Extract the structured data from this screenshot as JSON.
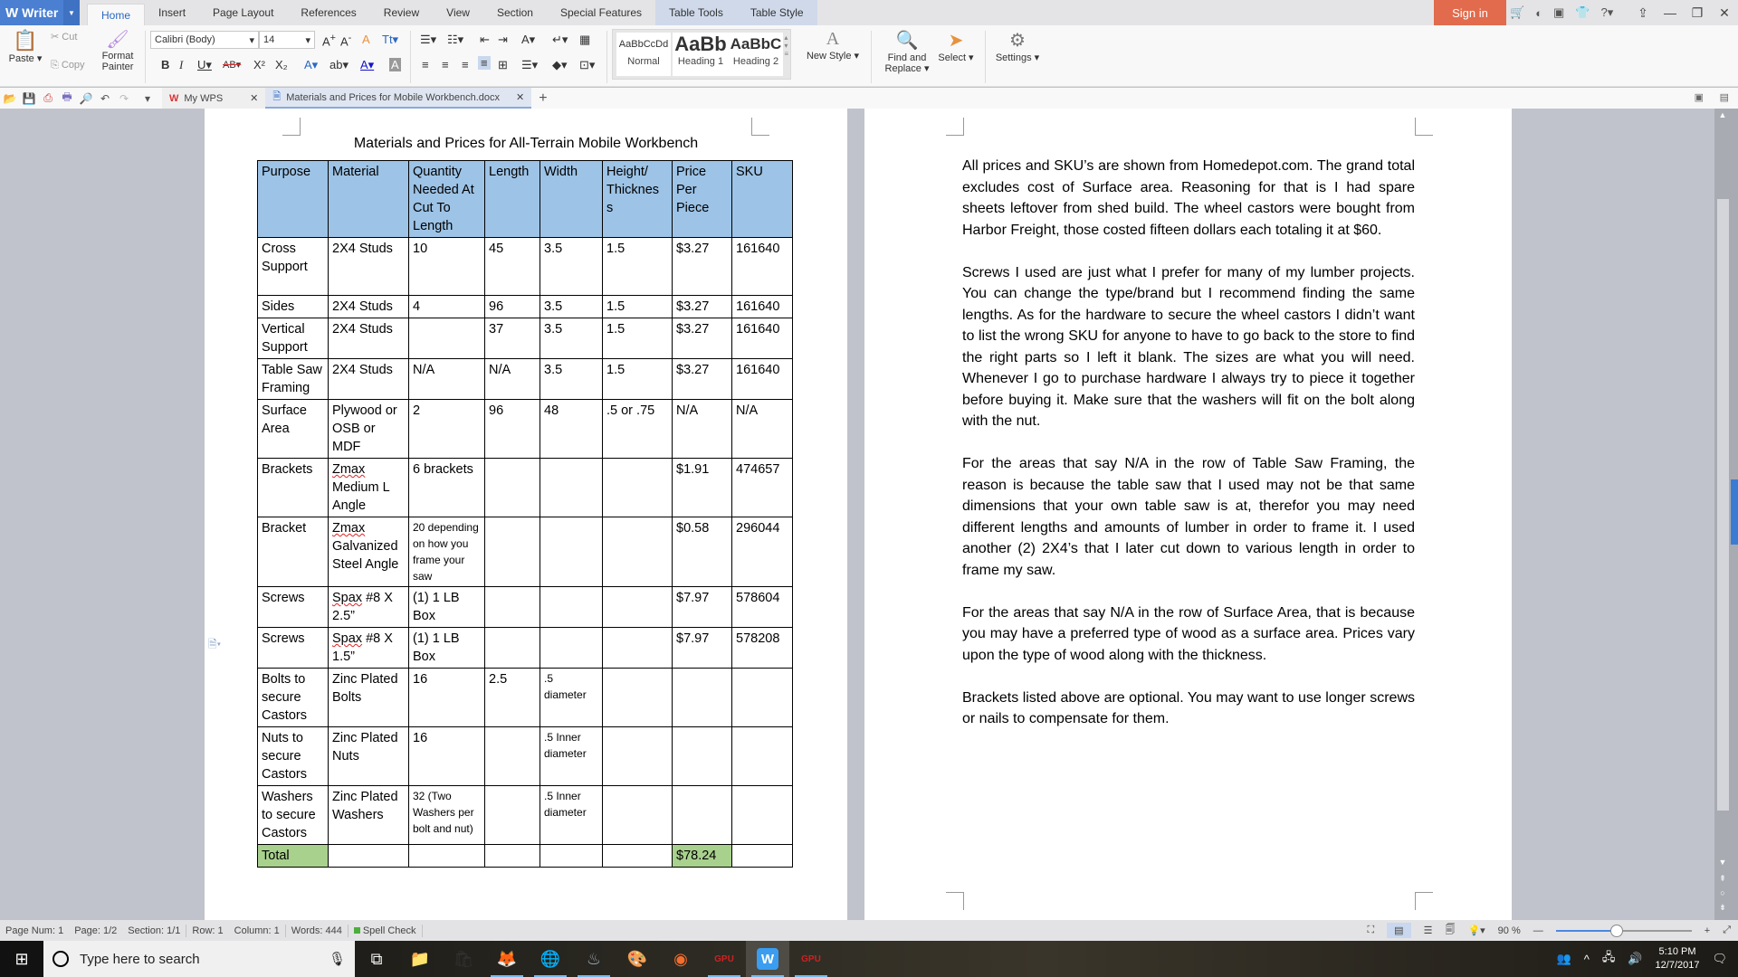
{
  "app": {
    "name": "Writer",
    "logo": "W"
  },
  "menu_tabs": [
    {
      "label": "Home",
      "active": true
    },
    {
      "label": "Insert"
    },
    {
      "label": "Page Layout"
    },
    {
      "label": "References"
    },
    {
      "label": "Review"
    },
    {
      "label": "View"
    },
    {
      "label": "Section"
    },
    {
      "label": "Special Features"
    },
    {
      "label": "Table Tools",
      "contextual": true
    },
    {
      "label": "Table Style",
      "contextual": true
    }
  ],
  "signin_label": "Sign in",
  "ribbon": {
    "paste": "Paste",
    "cut": "Cut",
    "copy": "Copy",
    "format_painter_1": "Format",
    "format_painter_2": "Painter",
    "font_name": "Calibri (Body)",
    "font_size": "14",
    "styles": [
      {
        "preview": "AaBbCcDd",
        "label": "Normal"
      },
      {
        "preview": "AaBb",
        "label": "Heading 1"
      },
      {
        "preview": "AaBbC",
        "label": "Heading 2"
      }
    ],
    "new_style": "New Style",
    "find_replace_1": "Find and",
    "find_replace_2": "Replace",
    "select": "Select",
    "settings": "Settings"
  },
  "doc_tabs": [
    {
      "label": "My WPS",
      "icon": "wps-icon"
    },
    {
      "label": "Materials and Prices for Mobile Workbench.docx",
      "icon": "doc-icon",
      "active": true
    }
  ],
  "document": {
    "title": "Materials and Prices for All-Terrain Mobile Workbench",
    "table": {
      "headers": [
        "Purpose",
        "Material",
        "Quantity Needed At Cut To Length",
        "Length",
        "Width",
        "Height/ Thicknes s",
        "Price Per Piece",
        "SKU"
      ],
      "rows": [
        [
          "Cross Support",
          "2X4 Studs",
          "10",
          "45",
          "3.5",
          "1.5",
          "$3.27",
          "161640"
        ],
        [
          "Sides",
          "2X4 Studs",
          "4",
          "96",
          "3.5",
          "1.5",
          "$3.27",
          "161640"
        ],
        [
          "Vertical Support",
          "2X4 Studs",
          "",
          "37",
          "3.5",
          "1.5",
          "$3.27",
          "161640"
        ],
        [
          "Table Saw Framing",
          "2X4 Studs",
          "N/A",
          "N/A",
          "3.5",
          "1.5",
          "$3.27",
          "161640"
        ],
        [
          "Surface Area",
          "Plywood or OSB or MDF",
          "2",
          "96",
          "48",
          ".5 or .75",
          "N/A",
          "N/A"
        ],
        [
          "Brackets",
          "Zmax Medium L Angle",
          "6 brackets",
          "",
          "",
          "",
          "$1.91",
          "474657"
        ],
        [
          "Bracket",
          "Zmax Galvanized Steel Angle",
          "20 depending on how you frame your saw",
          "",
          "",
          "",
          "$0.58",
          "296044"
        ],
        [
          "Screws",
          "Spax #8 X 2.5”",
          "(1) 1 LB Box",
          "",
          "",
          "",
          "$7.97",
          "578604"
        ],
        [
          "Screws",
          "Spax #8 X 1.5”",
          "(1) 1 LB Box",
          "",
          "",
          "",
          "$7.97",
          "578208"
        ],
        [
          "Bolts to secure Castors",
          "Zinc Plated Bolts",
          "16",
          "2.5",
          ".5 diameter",
          "",
          "",
          ""
        ],
        [
          "Nuts to secure Castors",
          "Zinc Plated Nuts",
          "16",
          "",
          ".5 Inner diameter",
          "",
          "",
          ""
        ],
        [
          "Washers to secure Castors",
          "Zinc Plated Washers",
          "32 (Two Washers per bolt and nut)",
          "",
          ".5 Inner diameter",
          "",
          "",
          ""
        ],
        [
          "Total",
          "",
          "",
          "",
          "",
          "",
          "$78.24",
          ""
        ]
      ]
    },
    "paragraphs": [
      "All prices and SKU’s are shown from Homedepot.com. The grand total excludes cost of Surface area. Reasoning for that is I had spare sheets leftover from shed build. The wheel castors were bought from Harbor Freight, those costed fifteen dollars each totaling it at $60.",
      "Screws I used are just what I prefer for many of my lumber projects. You can change the type/brand but I recommend finding the same lengths. As for the hardware to secure the wheel castors I didn’t want to list the wrong SKU for anyone to have to go back to the store to find the right parts so I left it blank. The sizes are what you will need. Whenever I go to purchase hardware I always try to piece it together before buying it. Make sure that the washers will fit on the bolt along with the nut.",
      "For the areas that say N/A in the row of Table Saw Framing, the reason is because the table saw that I used may not be that same dimensions that your own table saw is at, therefor you may need different lengths and amounts of lumber in order to frame it. I used another (2) 2X4’s that I later cut down to various length in order to frame my saw.",
      "For the areas that say N/A in the row of Surface Area, that is because you may have a preferred type of wood as a surface area. Prices vary upon the type of wood along with the thickness.",
      "Brackets listed above are optional. You may want to use longer screws or nails to compensate for them."
    ]
  },
  "status": {
    "page_num": "Page Num: 1",
    "page": "Page: 1/2",
    "section": "Section: 1/1",
    "row": "Row: 1",
    "column": "Column: 1",
    "words": "Words: 444",
    "spell_check": "Spell Check",
    "zoom_label": "90 %",
    "zoom_fraction": 0.45
  },
  "taskbar": {
    "search_placeholder": "Type here to search",
    "time": "5:10 PM",
    "date": "12/7/2017"
  },
  "colors": {
    "header_fill": "#9dc3e6",
    "total_fill": "#a9d18e",
    "accent": "#4a7fd1",
    "signin": "#e16b4c"
  }
}
